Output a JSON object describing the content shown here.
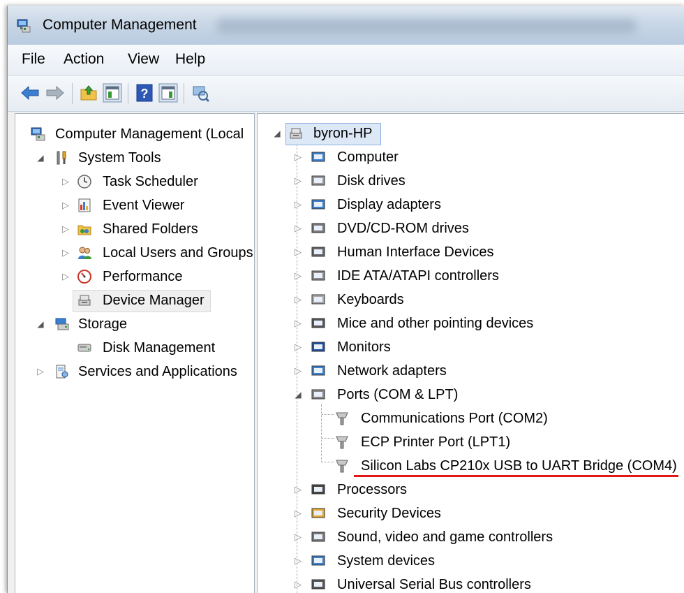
{
  "window": {
    "title": "Computer Management"
  },
  "menu": [
    "File",
    "Action",
    "View",
    "Help"
  ],
  "toolbar": {
    "buttons": [
      "back-icon",
      "forward-icon",
      "up-folder-icon",
      "show-hide-console-tree-icon",
      "help-icon",
      "show-hide-action-pane-icon",
      "properties-icon"
    ]
  },
  "left_tree": {
    "root": "Computer Management (Local",
    "system_tools": {
      "label": "System Tools",
      "children": [
        "Task Scheduler",
        "Event Viewer",
        "Shared Folders",
        "Local Users and Groups",
        "Performance",
        "Device Manager"
      ]
    },
    "storage": {
      "label": "Storage",
      "children": [
        "Disk Management"
      ]
    },
    "services": "Services and Applications"
  },
  "right_tree": {
    "root": "byron-HP",
    "categories": [
      "Computer",
      "Disk drives",
      "Display adapters",
      "DVD/CD-ROM drives",
      "Human Interface Devices",
      "IDE ATA/ATAPI controllers",
      "Keyboards",
      "Mice and other pointing devices",
      "Monitors",
      "Network adapters",
      "Ports (COM & LPT)",
      "Processors",
      "Security Devices",
      "Sound, video and game controllers",
      "System devices",
      "Universal Serial Bus controllers"
    ],
    "ports_children": [
      "Communications Port (COM2)",
      "ECP Printer Port (LPT1)",
      "Silicon Labs CP210x USB to UART Bridge (COM4)"
    ]
  },
  "colors": {
    "highlight_underline": "#e01818",
    "selection": "#dde8f7"
  }
}
